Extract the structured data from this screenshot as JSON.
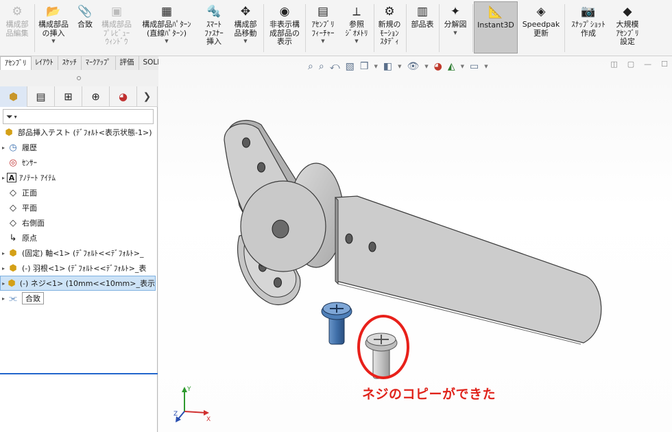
{
  "ribbon": {
    "items": [
      {
        "name": "edit-component-button",
        "icon": "⚙",
        "label": "構成部\n品編集",
        "disabled": true,
        "caret": false
      },
      {
        "name": "insert-component-button",
        "icon": "📂",
        "label": "構成部品\nの挿入",
        "disabled": false,
        "caret": true
      },
      {
        "name": "mate-button",
        "icon": "📎",
        "label": "合致",
        "disabled": false,
        "caret": false
      },
      {
        "name": "component-preview-button",
        "icon": "▣",
        "label": "構成部品\nﾌﾟﾚﾋﾞｭｰ\nｳｨﾝﾄﾞｳ",
        "disabled": true,
        "caret": false
      },
      {
        "name": "linear-pattern-button",
        "icon": "▦",
        "label": "構成部品ﾊﾟﾀｰﾝ\n(直線ﾊﾟﾀｰﾝ)",
        "disabled": false,
        "caret": true
      },
      {
        "name": "smart-fasteners-button",
        "icon": "🔩",
        "label": "ｽﾏｰﾄ\nﾌｧｽﾅｰ\n挿入",
        "disabled": false,
        "caret": false
      },
      {
        "name": "move-component-button",
        "icon": "✥",
        "label": "構成部\n品移動",
        "disabled": false,
        "caret": true
      },
      {
        "name": "show-hidden-button",
        "icon": "◉",
        "label": "非表示構\n成部品の\n表示",
        "disabled": false,
        "caret": false
      },
      {
        "name": "assembly-features-button",
        "icon": "▤",
        "label": "ｱｾﾝﾌﾞﾘ\nﾌｨｰﾁｬｰ",
        "disabled": false,
        "caret": true
      },
      {
        "name": "reference-geometry-button",
        "icon": "⟂",
        "label": "参照\nｼﾞｵﾒﾄﾘ",
        "disabled": false,
        "caret": true
      },
      {
        "name": "new-motion-study-button",
        "icon": "⚙",
        "label": "新規の\nﾓｰｼｮﾝ\nｽﾀﾃﾞｨ",
        "disabled": false,
        "caret": false
      },
      {
        "name": "bom-button",
        "icon": "▥",
        "label": "部品表",
        "disabled": false,
        "caret": false
      },
      {
        "name": "exploded-view-button",
        "icon": "✦",
        "label": "分解図",
        "disabled": false,
        "caret": true
      },
      {
        "name": "instant3d-button",
        "icon": "📐",
        "label": "Instant3D",
        "disabled": false,
        "caret": false,
        "active": true
      },
      {
        "name": "speedpak-button",
        "icon": "◈",
        "label": "Speedpak\n更新",
        "disabled": false,
        "caret": false
      },
      {
        "name": "snapshot-button",
        "icon": "📷",
        "label": "ｽﾅｯﾌﾟｼｮｯﾄ\n作成",
        "disabled": false,
        "caret": false
      },
      {
        "name": "large-assembly-button",
        "icon": "◆",
        "label": "大規模\nｱｾﾝﾌﾞﾘ\n設定",
        "disabled": false,
        "caret": false
      }
    ]
  },
  "tabs": [
    "ｱｾﾝﾌﾞﾘ",
    "ﾚｲｱｳﾄ",
    "ｽｹｯﾁ",
    "ﾏｰｸｱｯﾌﾟ",
    "評価",
    "SOLIDWORKS ｱﾄﾞｲﾝ"
  ],
  "panel": {
    "more": "❯",
    "filter_icon": "filter-icon",
    "filter_caret": "▾",
    "tree": [
      {
        "name": "tree-root-assembly",
        "icon": "⬢",
        "label": "部品挿入テスト (ﾃﾞﾌｫﾙﾄ<表示状態-1>)",
        "toggle": "",
        "root": true
      },
      {
        "name": "tree-item-history",
        "icon": "◷",
        "label": "履歴",
        "toggle": "▸"
      },
      {
        "name": "tree-item-sensors",
        "icon": "◎",
        "label": "ｾﾝｻｰ",
        "toggle": ""
      },
      {
        "name": "tree-item-annotations",
        "icon": "A",
        "label": "ｱﾉﾃｰﾄ ｱｲﾃﾑ",
        "toggle": "▸"
      },
      {
        "name": "tree-item-front-plane",
        "icon": "◇",
        "label": "正面",
        "toggle": ""
      },
      {
        "name": "tree-item-top-plane",
        "icon": "◇",
        "label": "平面",
        "toggle": ""
      },
      {
        "name": "tree-item-right-plane",
        "icon": "◇",
        "label": "右側面",
        "toggle": ""
      },
      {
        "name": "tree-item-origin",
        "icon": "↳",
        "label": "原点",
        "toggle": ""
      },
      {
        "name": "tree-item-shaft",
        "icon": "⬢",
        "label": "(固定) 軸<1> (ﾃﾞﾌｫﾙﾄ<<ﾃﾞﾌｫﾙﾄ>_",
        "toggle": "▸"
      },
      {
        "name": "tree-item-blade",
        "icon": "⬢",
        "label": "(-) 羽根<1> (ﾃﾞﾌｫﾙﾄ<<ﾃﾞﾌｫﾙﾄ>_表",
        "toggle": "▸"
      },
      {
        "name": "tree-item-screw",
        "icon": "⬢",
        "label": "(-) ネジ<1> (10mm<<10mm>_表示",
        "toggle": "▸",
        "selected": true
      },
      {
        "name": "tree-item-mates",
        "icon": "⫘",
        "label": "合致",
        "toggle": "▸",
        "boxed": true
      }
    ]
  },
  "viewport": {
    "annotation": "ネジのコピーができた",
    "triad": {
      "x": "X",
      "y": "Y",
      "z": "Z"
    },
    "colors": {
      "annotation": "#e0231b",
      "part": "#c4c4c4",
      "screw_copy": "#3d6fa8",
      "highlight": "#e8201a"
    }
  }
}
